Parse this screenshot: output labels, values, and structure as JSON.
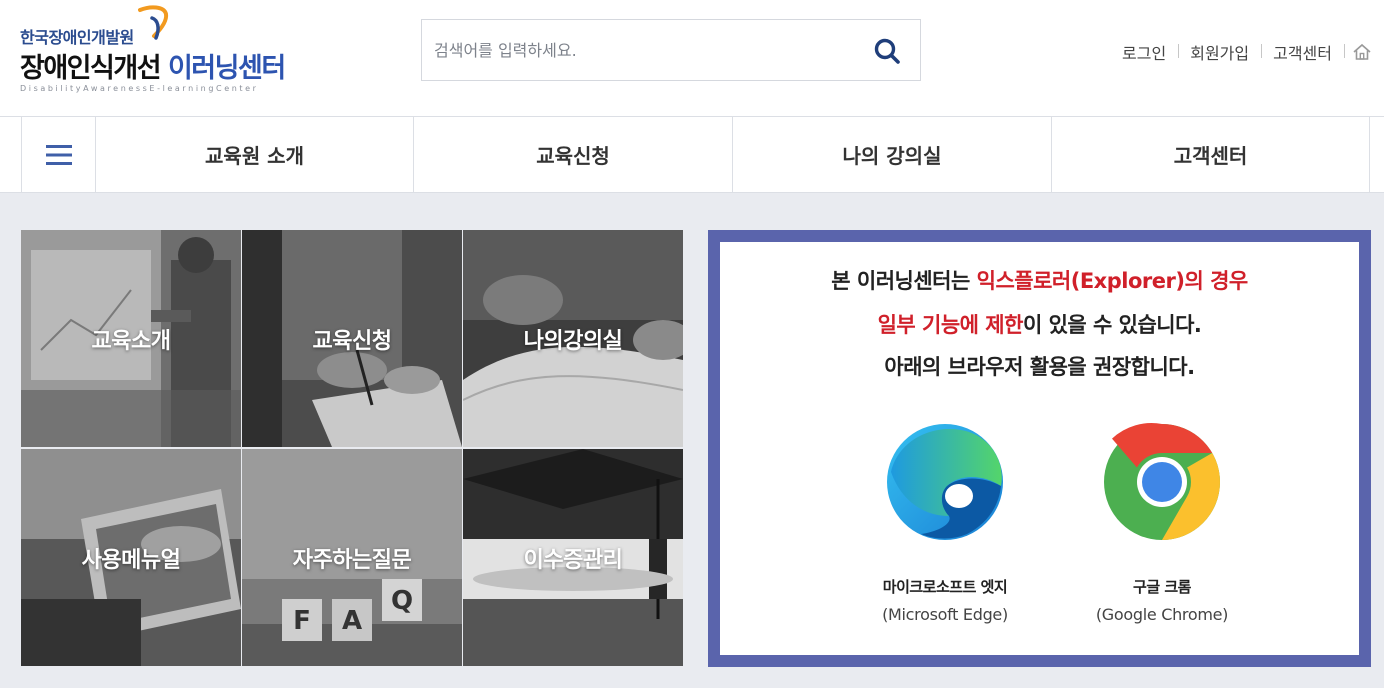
{
  "header": {
    "org_name": "한국장애인개발원",
    "site_name_a": "장애인식개선",
    "site_name_b": "이러닝센터",
    "site_sub": "DisabilityAwarenessE-learningCenter",
    "search_placeholder": "검색어를 입력하세요.",
    "util_links": [
      "로그인",
      "회원가입",
      "고객센터"
    ]
  },
  "nav": {
    "items": [
      "교육원 소개",
      "교육신청",
      "나의 강의실",
      "고객센터"
    ]
  },
  "tiles": [
    "교육소개",
    "교육신청",
    "나의강의실",
    "사용메뉴얼",
    "자주하는질문",
    "이수증관리"
  ],
  "notice": {
    "line1_a": "본 이러닝센터는 ",
    "line1_red": "익스플로러(Explorer)의 경우",
    "line2_red": "일부 기능에 제한",
    "line2_b": "이 있을 수 있습니다.",
    "line3": "아래의 브라우저 활용을 권장합니다.",
    "browsers": [
      {
        "name": "마이크로소프트 엣지",
        "en": "(Microsoft Edge)",
        "icon": "edge-icon"
      },
      {
        "name": "구글 크롬",
        "en": "(Google Chrome)",
        "icon": "chrome-icon"
      }
    ]
  },
  "colors": {
    "brand_blue": "#2d54b0",
    "notice_frame": "#5a64ac",
    "notice_red": "#d0202a"
  }
}
